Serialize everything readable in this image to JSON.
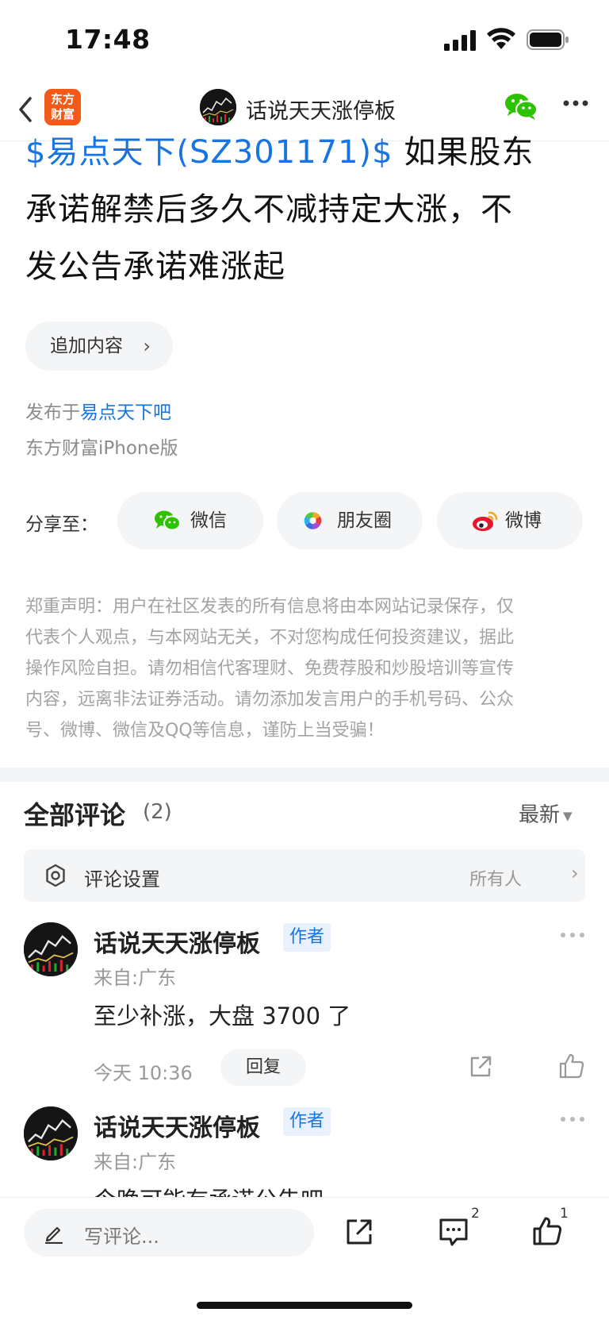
{
  "status_bar": {
    "time": "17:48"
  },
  "navbar": {
    "app_logo_line1": "东方",
    "app_logo_line2": "财富",
    "title": "话说天天涨停板"
  },
  "post": {
    "title_link": "$易点天下(SZ301171)$",
    "title_text_line1": "  如果股东",
    "title_text_line2": "承诺解禁后多久不减持定大涨，不",
    "title_text_line3": "发公告承诺难涨起",
    "append_label": "追加内容",
    "publish_prefix": "发布于",
    "publish_bar": "易点天下吧",
    "client": "东方财富iPhone版"
  },
  "share": {
    "label": "分享至：",
    "buttons": [
      {
        "label": "微信",
        "icon": "wechat-icon"
      },
      {
        "label": "朋友圈",
        "icon": "moments-icon"
      },
      {
        "label": "微博",
        "icon": "weibo-icon"
      }
    ]
  },
  "disclaimer": {
    "lines": [
      "郑重声明：用户在社区发表的所有信息将由本网站记录保存，仅",
      "代表个人观点，与本网站无关，不对您构成任何投资建议，据此",
      "操作风险自担。请勿相信代客理财、免费荐股和炒股培训等宣传",
      "内容，远离非法证券活动。请勿添加发言用户的手机号码、公众",
      "号、微博、微信及QQ等信息，谨防上当受骗！"
    ]
  },
  "comments": {
    "title": "全部评论",
    "count": "(2)",
    "sort": "最新",
    "settings_label": "评论设置",
    "settings_value": "所有人",
    "items": [
      {
        "name": "话说天天涨停板",
        "badge": "作者",
        "location": "来自:广东",
        "text": "至少补涨，大盘 3700 了",
        "time": "今天 10:36",
        "reply": "回复"
      },
      {
        "name": "话说天天涨停板",
        "badge": "作者",
        "location": "来自:广东",
        "text": "今晚可能有承诺公告吧"
      }
    ]
  },
  "bottom_bar": {
    "input_placeholder": "写评论...",
    "comment_count": "2",
    "like_count": "1"
  },
  "colors": {
    "link_blue": "#1874e0",
    "brand_orange": "#f25a1a",
    "wechat_green": "#2dc100",
    "weibo_red": "#e6162d"
  }
}
